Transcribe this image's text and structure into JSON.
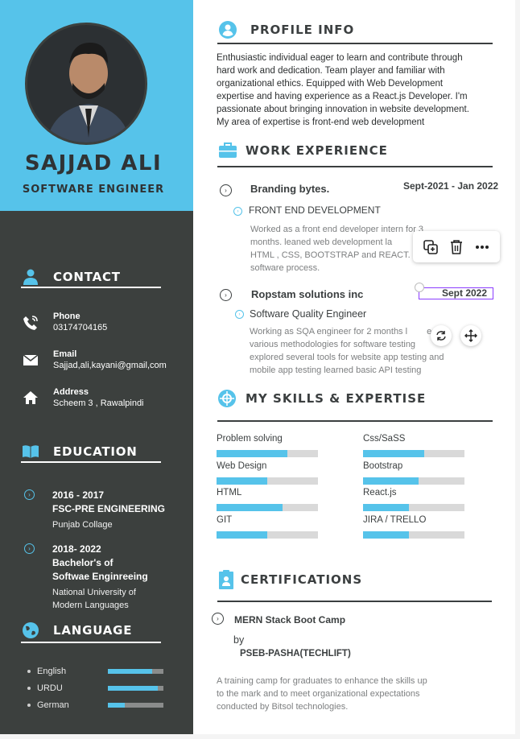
{
  "header": {
    "name": "SAJJAD ALI",
    "title": "SOFTWARE ENGINEER"
  },
  "contact": {
    "heading": "CONTACT",
    "phone_label": "Phone",
    "phone_value": "03174704165",
    "email_label": "Email",
    "email_value": "Sajjad,ali,kayani@gmail,com",
    "address_label": "Address",
    "address_value": "Scheem 3 , Rawalpindi"
  },
  "education": {
    "heading": "EDUCATION",
    "items": [
      {
        "year": "2016 - 2017",
        "degree": "FSC-PRE ENGINEERING",
        "institution": "Punjab Collage"
      },
      {
        "year": "2018- 2022",
        "degree_line1": "Bachelor's of",
        "degree_line2": "Softwae Enginreeing",
        "institution_line1": "National University of",
        "institution_line2": "Modern Languages"
      }
    ]
  },
  "language": {
    "heading": "LANGUAGE",
    "items": [
      {
        "name": "English",
        "level": 0.8
      },
      {
        "name": "URDU",
        "level": 0.9
      },
      {
        "name": "German",
        "level": 0.3
      }
    ]
  },
  "profile": {
    "heading": "PROFILE INFO",
    "lines": [
      "Enthusiastic individual eager to learn and contribute through",
      "hard work and dedication. Team player and familiar with",
      "organizational ethics.  Equipped with Web Development",
      "expertise and having experience as a React.js Developer. I'm",
      "passionate about bringing innovation in website development.",
      "My area of expertise is front-end web development"
    ]
  },
  "work": {
    "heading": "WORK EXPERIENCE",
    "jobs": [
      {
        "company": "Branding bytes.",
        "dates": "Sept-2021 - Jan 2022",
        "position": "FRONT END DEVELOPMENT",
        "lines": [
          "Worked as a front end developer intern for 3",
          "months. leaned web development la",
          "HTML , CSS, BOOTSTRAP and REACT.",
          "software process."
        ]
      },
      {
        "company": "Ropstam solutions inc",
        "dates": "Sept 2022",
        "position": "Software Quality Engineer",
        "lines": [
          "Working as SQA engineer  for 2 months l",
          "various methodologies for software testing",
          "explored several tools for website app testing and",
          "mobile app testing learned basic API testing"
        ],
        "line1_tail": "ed"
      }
    ]
  },
  "skills": {
    "heading": "MY SKILLS & EXPERTISE",
    "left": [
      {
        "name": "Problem solving",
        "level": 0.7
      },
      {
        "name": "Web Design",
        "level": 0.5
      },
      {
        "name": "HTML",
        "level": 0.65
      },
      {
        "name": "GIT",
        "level": 0.5
      }
    ],
    "right": [
      {
        "name": "Css/SaSS",
        "level": 0.6
      },
      {
        "name": "Bootstrap",
        "level": 0.55
      },
      {
        "name": "React.js",
        "level": 0.45
      },
      {
        "name": "JIRA / TRELLO",
        "level": 0.45
      }
    ]
  },
  "certifications": {
    "heading": "CERTIFICATIONS",
    "title": "MERN Stack Boot Camp",
    "by": "by",
    "issuer": "PSEB-PASHA(TECHLIFT)",
    "lines": [
      "A training camp for graduates to enhance the skills up",
      "to the mark and to meet organizational expectations",
      "conducted by Bitsol technologies."
    ]
  },
  "colors": {
    "accent": "#56c3ea",
    "sidebar_dark": "#3c403e",
    "text_dark": "#3b3f40",
    "selection": "#8b3dff"
  },
  "icons": {
    "toolbar": [
      "duplicate-icon",
      "trash-icon",
      "more-icon"
    ],
    "floating": [
      "rotate-icon",
      "move-icon"
    ]
  }
}
